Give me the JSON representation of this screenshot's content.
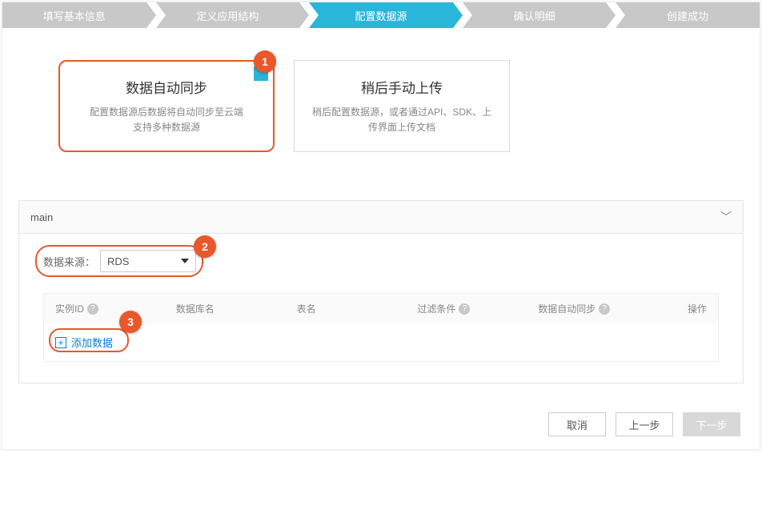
{
  "steps": {
    "s1": "填写基本信息",
    "s2": "定义应用结构",
    "s3": "配置数据源",
    "s4": "确认明细",
    "s5": "创建成功"
  },
  "cards": {
    "auto": {
      "title": "数据自动同步",
      "desc": "配置数据源后数据将自动同步至云端\n支持多种数据源"
    },
    "manual": {
      "title": "稍后手动上传",
      "desc": "稍后配置数据源，或者通过API、SDK、上传界面上传文档"
    }
  },
  "badges": {
    "b1": "1",
    "b2": "2",
    "b3": "3"
  },
  "panel": {
    "title": "main"
  },
  "source": {
    "label": "数据来源：",
    "value": "RDS"
  },
  "table": {
    "headers": {
      "id": "实例ID",
      "db": "数据库名",
      "tbl": "表名",
      "filter": "过滤条件",
      "sync": "数据自动同步",
      "ops": "操作"
    },
    "add": "添加数据"
  },
  "footer": {
    "cancel": "取消",
    "prev": "上一步",
    "next": "下一步"
  }
}
